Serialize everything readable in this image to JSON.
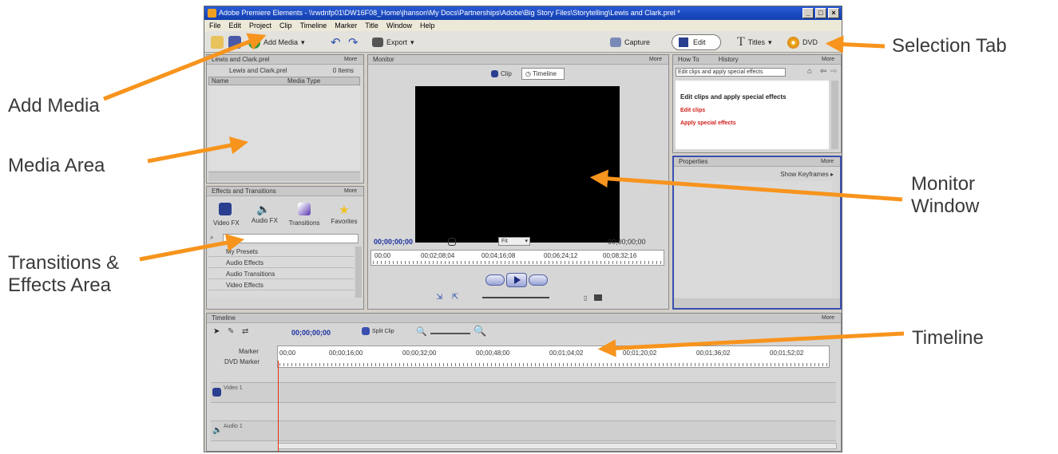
{
  "window": {
    "title": "Adobe Premiere Elements - \\\\rwdnfp01\\DW16F08_Home\\jhanson\\My Docs\\Partnerships\\Adobe\\Big Story Files\\Storytelling\\Lewis and Clark.prel *",
    "controls": [
      "_",
      "□",
      "×"
    ]
  },
  "menu": [
    "File",
    "Edit",
    "Project",
    "Clip",
    "Timeline",
    "Marker",
    "Title",
    "Window",
    "Help"
  ],
  "toolbar": {
    "add_media": "Add Media",
    "export": "Export",
    "capture": "Capture",
    "edit": "Edit",
    "titles": "Titles",
    "dvd": "DVD"
  },
  "media_panel": {
    "title": "Lewis and Clark.prel",
    "more": "More",
    "project_file": "Lewis and Clark.prel",
    "count": "0 Items",
    "col_name": "Name",
    "col_type": "Media Type"
  },
  "effects_panel": {
    "title": "Effects and Transitions",
    "more": "More",
    "categories": [
      "Video FX",
      "Audio FX",
      "Transitions",
      "Favorites"
    ],
    "tree": [
      "My Presets",
      "Audio Effects",
      "Audio Transitions",
      "Video Effects"
    ]
  },
  "monitor": {
    "title": "Monitor",
    "more": "More",
    "clip_tab": "Clip",
    "timeline_tab": "Timeline",
    "current_time": "00;00;00;00",
    "fit": "Fit",
    "duration": "00;00;00;00",
    "ruler_labels": [
      "00;00",
      "00;02;08;04",
      "00;04;16;08",
      "00;06;24;12",
      "00;08;32;16"
    ]
  },
  "howto_panel": {
    "tab_howto": "How To",
    "tab_history": "History",
    "more": "More",
    "topic": "Edit clips and apply special effects",
    "heading": "Edit clips and apply special effects",
    "links": [
      "Edit clips",
      "Apply special effects"
    ]
  },
  "properties_panel": {
    "title": "Properties",
    "more": "More",
    "keyframes": "Show Keyframes"
  },
  "timeline": {
    "title": "Timeline",
    "more": "More",
    "time": "00;00;00;00",
    "split_clip": "Split Clip",
    "ruler_labels": [
      "00;00",
      "00;00;16;00",
      "00;00;32;00",
      "00;00;48;00",
      "00;01;04;02",
      "00;01;20;02",
      "00;01;36;02",
      "00;01;52;02"
    ],
    "markers_label": "Marker",
    "dvd_markers_label": "DVD Marker",
    "tracks": [
      "Video 1",
      "Audio 1"
    ]
  },
  "callouts": {
    "add_media": "Add Media",
    "media_area": "Media Area",
    "transitions_line1": "Transitions &",
    "transitions_line2": "Effects Area",
    "selection_tab": "Selection Tab",
    "monitor_line1": "Monitor",
    "monitor_line2": "Window",
    "timeline": "Timeline"
  },
  "colors": {
    "arrow": "#f7941d",
    "title_bar": "#1f4fc4",
    "active_time": "#1a2fa0"
  }
}
